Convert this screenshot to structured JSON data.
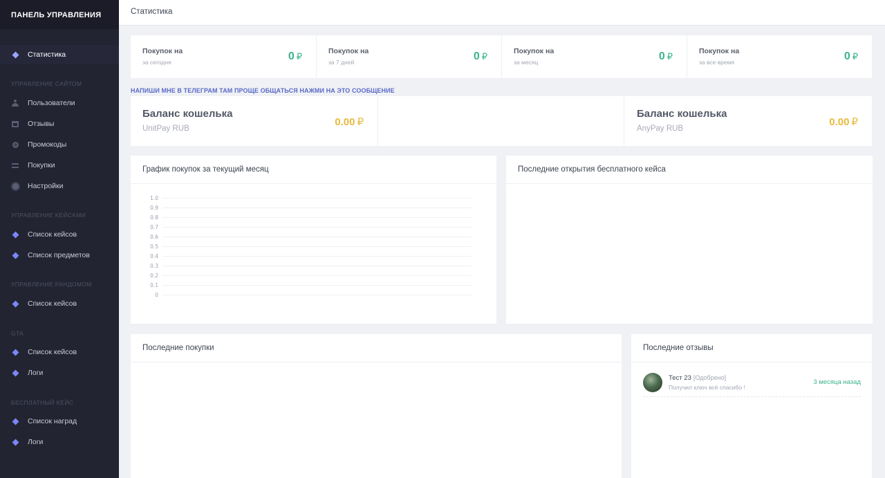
{
  "sidebar": {
    "title": "ПАНЕЛЬ УПРАВЛЕНИЯ",
    "active": {
      "label": "Статистика"
    },
    "sections": {
      "site": {
        "label": "УПРАВЛЕНИЕ САЙТОМ",
        "items": [
          {
            "label": "Пользователи"
          },
          {
            "label": "Отзывы"
          },
          {
            "label": "Промокоды"
          },
          {
            "label": "Покупки"
          },
          {
            "label": "Настройки"
          }
        ]
      },
      "cases": {
        "label": "УПРАВЛЕНИЕ КЕЙСАМИ",
        "items": [
          {
            "label": "Список кейсов"
          },
          {
            "label": "Список предметов"
          }
        ]
      },
      "random": {
        "label": "УПРАВЛЕНИЕ РАНДОМОМ",
        "items": [
          {
            "label": "Список кейсов"
          }
        ]
      },
      "gta": {
        "label": "GTA",
        "items": [
          {
            "label": "Список кейсов"
          },
          {
            "label": "Логи"
          }
        ]
      },
      "free": {
        "label": "БЕСПЛАТНЫЙ КЕЙС",
        "items": [
          {
            "label": "Список наград"
          },
          {
            "label": "Логи"
          }
        ]
      }
    }
  },
  "topbar": {
    "title": "Статистика"
  },
  "stats": [
    {
      "title": "Покупок на",
      "sub": "за сегодня",
      "value": "0",
      "currency": "₽"
    },
    {
      "title": "Покупок на",
      "sub": "за 7 дней",
      "value": "0",
      "currency": "₽"
    },
    {
      "title": "Покупок на",
      "sub": "за месяц",
      "value": "0",
      "currency": "₽"
    },
    {
      "title": "Покупок на",
      "sub": "за все время",
      "value": "0",
      "currency": "₽"
    }
  ],
  "telegram_link": "НАПИШИ МНЕ В ТЕЛЕГРАМ ТАМ ПРОЩЕ ОБЩАТЬСЯ НАЖМИ НА ЭТО СООБЩЕНИЕ",
  "wallets": [
    {
      "title": "Баланс кошелька",
      "provider": "UnitPay RUB",
      "value": "0.00",
      "currency": "₽"
    },
    {
      "title": "Баланс кошелька",
      "provider": "AnyPay RUB",
      "value": "0.00",
      "currency": "₽"
    }
  ],
  "panels": {
    "chart_title": "График покупок за текущий месяц",
    "free_case_title": "Последние открытия бесплатного кейса",
    "purchases_title": "Последние покупки",
    "reviews_title": "Последние отзывы"
  },
  "reviews": [
    {
      "name": "Тест 23",
      "status": "[Одобрено]",
      "text": "Получил ключ всё спасибо !",
      "time": "3 месяца назад"
    }
  ],
  "chart_data": {
    "type": "line",
    "title": "График покупок за текущий месяц",
    "xlabel": "",
    "ylabel": "",
    "ylim": [
      0,
      1.0
    ],
    "y_ticks": [
      "1.0",
      "0.9",
      "0.8",
      "0.7",
      "0.6",
      "0.5",
      "0.4",
      "0.3",
      "0.2",
      "0.1",
      "0"
    ],
    "series": [],
    "grid": true
  },
  "colors": {
    "sidebar_bg": "#222432",
    "accent_green": "#3cb488",
    "accent_gold": "#e8b93f",
    "link_blue": "#5a6ac7"
  }
}
